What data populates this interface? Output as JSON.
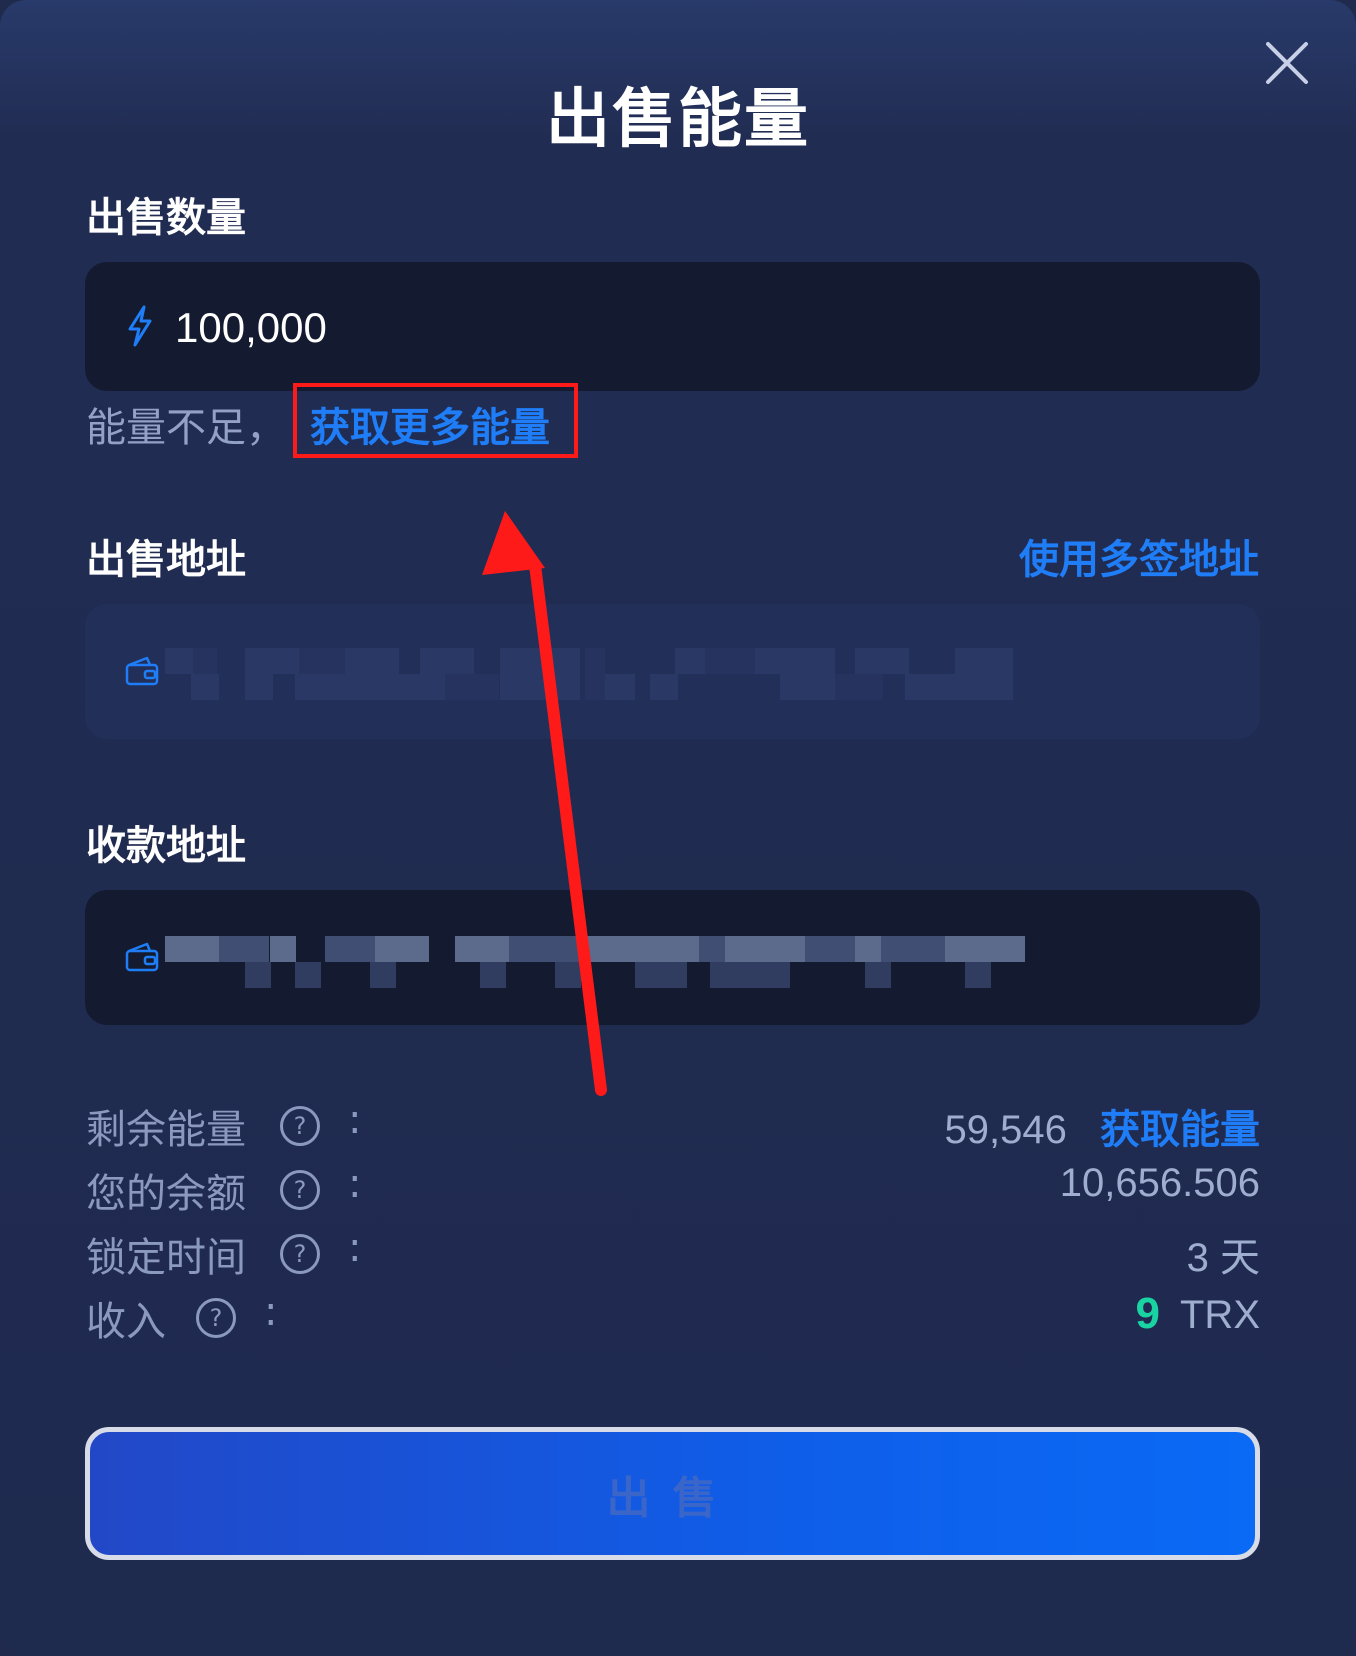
{
  "modal": {
    "title": "出售能量",
    "close_icon": "close-icon"
  },
  "amount": {
    "label": "出售数量",
    "value": "100,000",
    "icon": "lightning-icon"
  },
  "insufficient": {
    "text": "能量不足，",
    "link": "获取更多能量"
  },
  "sell_address": {
    "label": "出售地址",
    "multisig_link": "使用多签地址",
    "icon": "wallet-icon"
  },
  "receive_address": {
    "label": "收款地址",
    "icon": "wallet-icon"
  },
  "info": {
    "remaining_energy": {
      "label": "剩余能量",
      "colon": ":",
      "value": "59,546",
      "link": "获取能量"
    },
    "balance": {
      "label": "您的余额",
      "colon": ":",
      "value": "10,656.506"
    },
    "lock_time": {
      "label": "锁定时间",
      "colon": ":",
      "value": "3 天"
    },
    "income": {
      "label": "收入",
      "colon": ":",
      "amount": "9",
      "unit": "TRX"
    }
  },
  "sell_button": {
    "label": "出售"
  },
  "colors": {
    "accent_blue": "#1f7ef7",
    "income_green": "#19d3a2",
    "annotation_red": "#ff1a1a"
  }
}
